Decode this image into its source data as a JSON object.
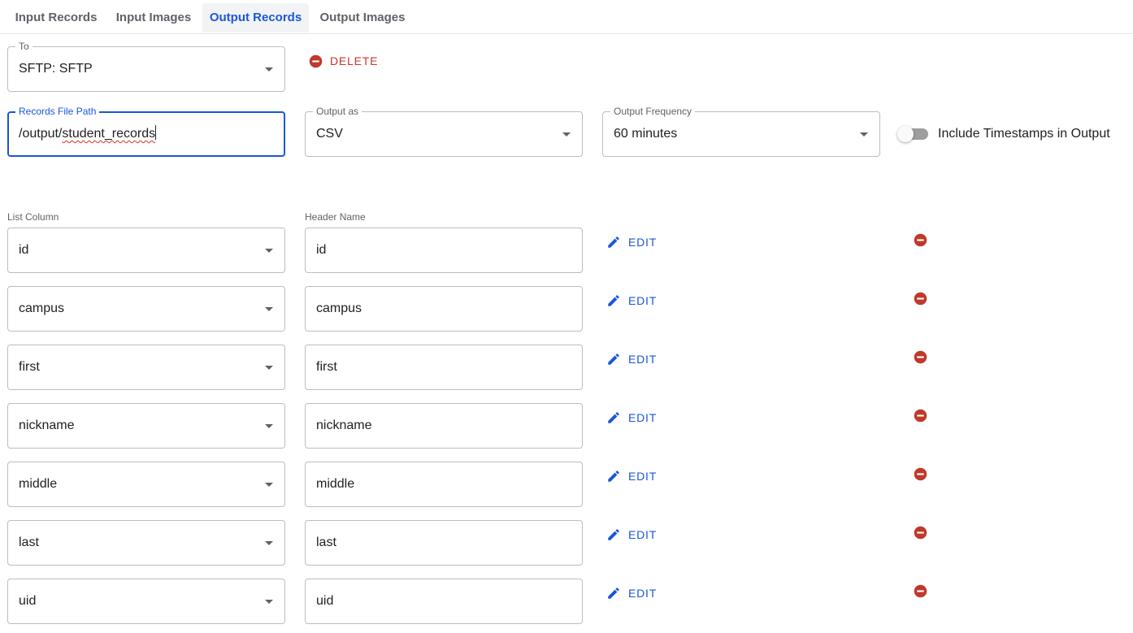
{
  "tabs": [
    {
      "label": "Input Records"
    },
    {
      "label": "Input Images"
    },
    {
      "label": "Output Records",
      "active": true
    },
    {
      "label": "Output Images"
    }
  ],
  "destination": {
    "label": "To",
    "value": "SFTP: SFTP"
  },
  "delete_button": {
    "label": "DELETE"
  },
  "records_file_path": {
    "label": "Records File Path",
    "value_plain": "/output/",
    "value_underlined": "student_records"
  },
  "output_as": {
    "label": "Output as",
    "value": "CSV"
  },
  "output_frequency": {
    "label": "Output Frequency",
    "value": "60 minutes"
  },
  "timestamps_toggle": {
    "label": "Include Timestamps in Output",
    "checked": false
  },
  "columns_header": {
    "list_column": "List Column",
    "header_name": "Header Name"
  },
  "edit_label": "EDIT",
  "rows": [
    {
      "list_column": "id",
      "header_name": "id"
    },
    {
      "list_column": "campus",
      "header_name": "campus"
    },
    {
      "list_column": "first",
      "header_name": "first"
    },
    {
      "list_column": "nickname",
      "header_name": "nickname"
    },
    {
      "list_column": "middle",
      "header_name": "middle"
    },
    {
      "list_column": "last",
      "header_name": "last"
    },
    {
      "list_column": "uid",
      "header_name": "uid"
    }
  ],
  "colors": {
    "accent": "#1a56db",
    "danger": "#c0392b",
    "border": "#bdbdbd"
  },
  "icons": {
    "delete": "remove-circle-icon",
    "edit": "pencil-icon",
    "dropdown": "arrow-drop-down-icon"
  }
}
